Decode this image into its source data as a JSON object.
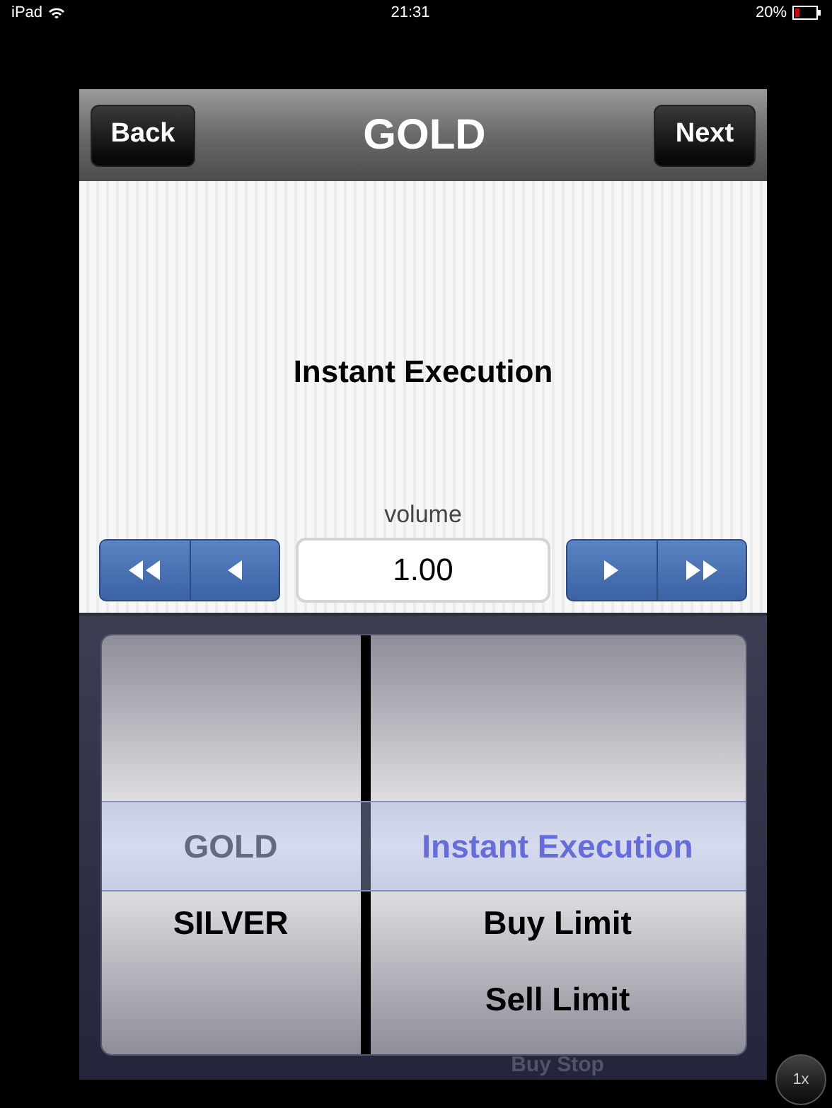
{
  "status_bar": {
    "device": "iPad",
    "time": "21:31",
    "battery": "20%"
  },
  "nav_bar": {
    "back": "Back",
    "title": "GOLD",
    "next": "Next"
  },
  "order_type": "Instant Execution",
  "volume": {
    "label": "volume",
    "value": "1.00"
  },
  "picker": {
    "columns": [
      {
        "items": [
          {
            "label": "GOLD",
            "selected": true
          },
          {
            "label": "SILVER",
            "selected": false
          }
        ]
      },
      {
        "items": [
          {
            "label": "Instant Execution",
            "selected": true
          },
          {
            "label": "Buy Limit",
            "selected": false
          },
          {
            "label": "Sell Limit",
            "selected": false
          }
        ],
        "below": "Buy Stop"
      }
    ]
  },
  "zoom_button": "1x"
}
